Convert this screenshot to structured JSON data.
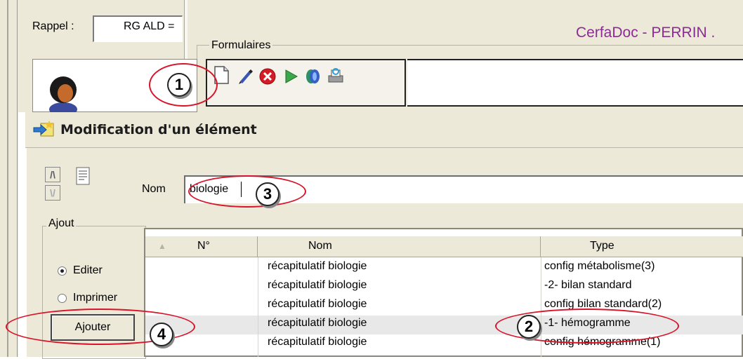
{
  "rappel": {
    "label": "Rappel :",
    "value": "RG ALD ="
  },
  "app_title": "CerfaDoc - PERRIN .",
  "formulaires": {
    "label": "Formulaires",
    "toolbar_icons": [
      "new-document-icon",
      "pen-icon",
      "delete-icon",
      "play-icon",
      "book-icon",
      "print-preview-icon"
    ]
  },
  "dialog": {
    "title": "Modification d'un élément",
    "up_arrow": "/\\",
    "down_arrow": "\\/",
    "nom_label": "Nom",
    "nom_value": "biologie",
    "ajout_label": "Ajout",
    "options": [
      {
        "label": "Editer",
        "selected": true
      },
      {
        "label": "Imprimer",
        "selected": false
      }
    ],
    "add_button": "Ajouter"
  },
  "table": {
    "columns": [
      "N°",
      "Nom",
      "Type"
    ],
    "sort_indicator": "▲",
    "rows": [
      {
        "num": "",
        "nom": "récapitulatif biologie",
        "type": "config métabolisme(3)"
      },
      {
        "num": "",
        "nom": "récapitulatif biologie",
        "type": "-2- bilan standard"
      },
      {
        "num": "",
        "nom": "récapitulatif biologie",
        "type": "config bilan standard(2)"
      },
      {
        "num": "",
        "nom": "récapitulatif biologie",
        "type": "-1- hémogramme"
      },
      {
        "num": "",
        "nom": "récapitulatif biologie",
        "type": "config hémogramme(1)"
      }
    ],
    "selected_row_index": 3
  },
  "callouts": [
    "1",
    "2",
    "3",
    "4"
  ],
  "colors": {
    "callout_ellipse": "#d8142a",
    "title_purple": "#8b2c94",
    "window_bg": "#ece9d8"
  }
}
